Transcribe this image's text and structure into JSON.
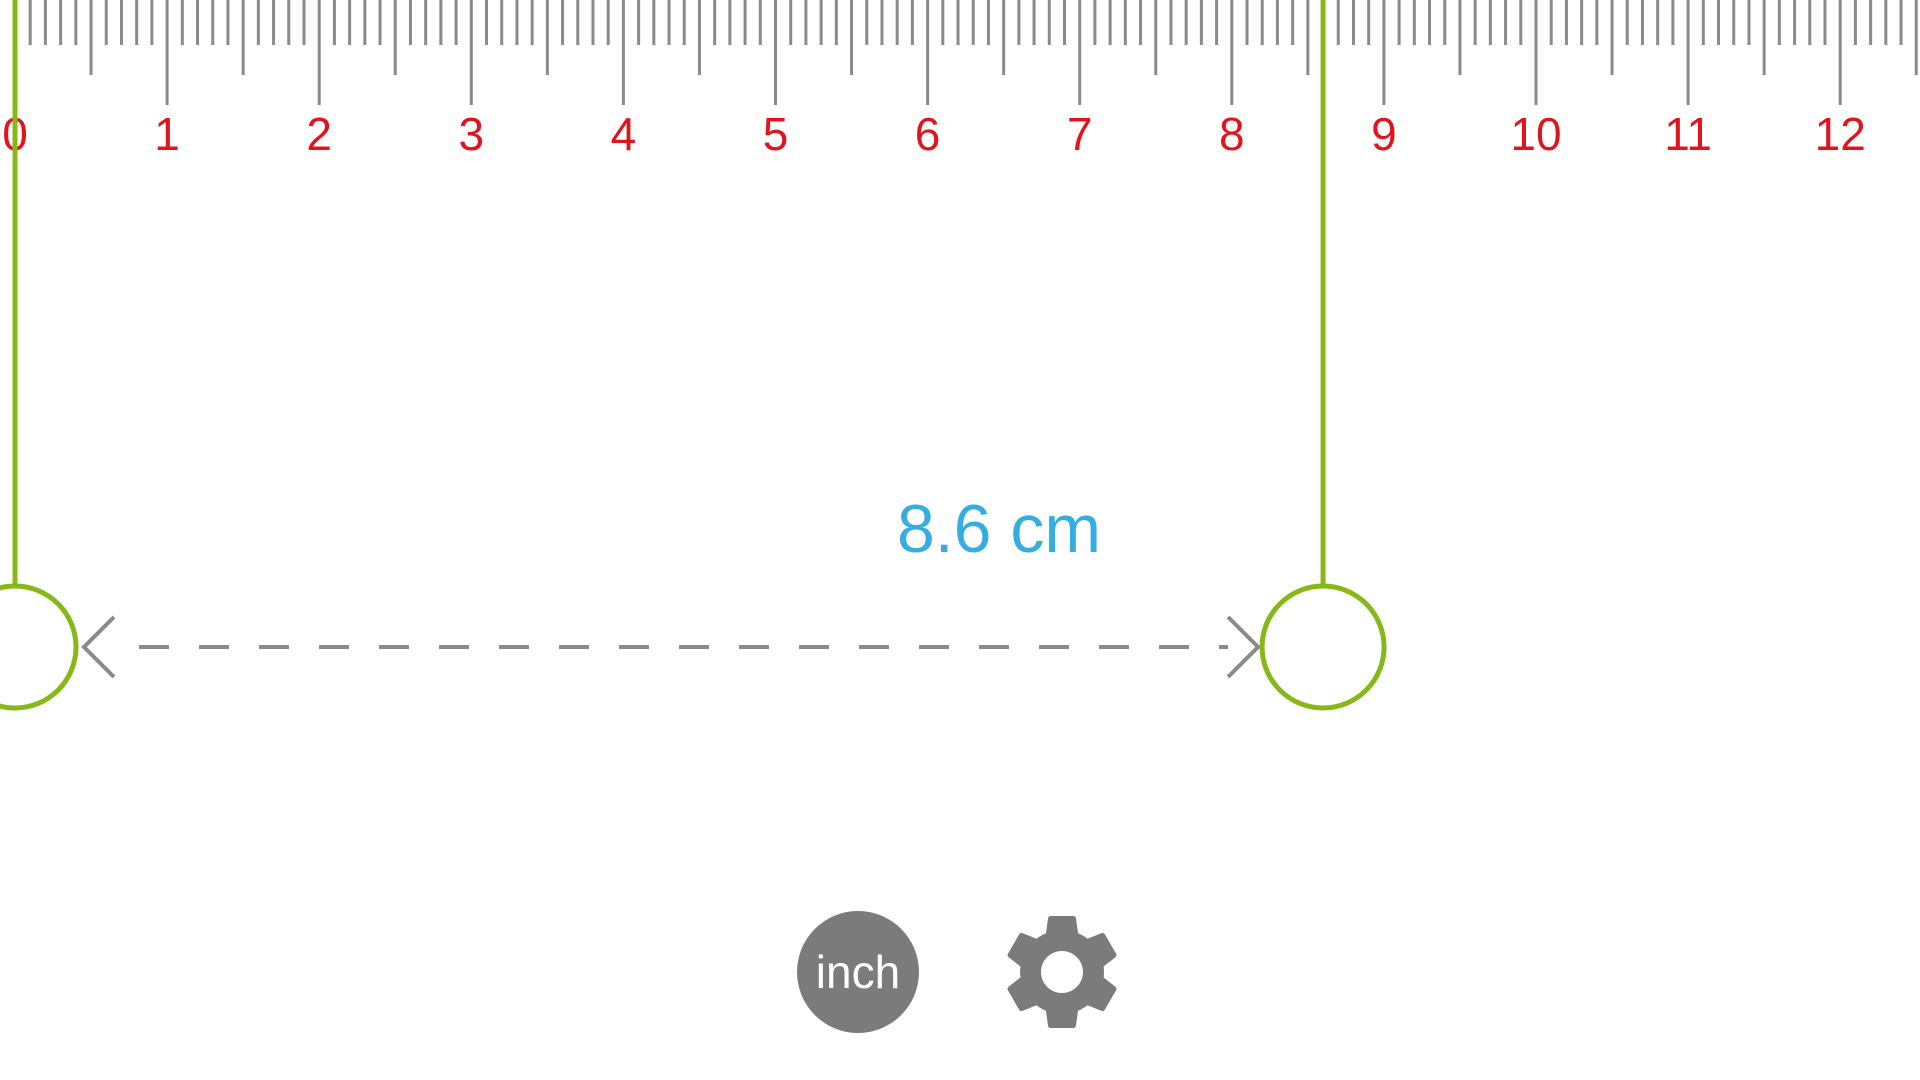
{
  "ruler": {
    "unit": "cm",
    "labels": [
      "0",
      "1",
      "2",
      "3",
      "4",
      "5",
      "6",
      "7",
      "8",
      "9",
      "10",
      "11",
      "12"
    ],
    "tick_color": "#8a8a8a",
    "label_color": "#e0141c"
  },
  "markers": {
    "start_cm": 0,
    "end_cm": 8.6,
    "color": "#86b817"
  },
  "measurement": {
    "text": "8.6 cm",
    "color": "#35ade0"
  },
  "controls": {
    "unit_toggle_label": "inch",
    "settings_icon": "gear-icon"
  }
}
